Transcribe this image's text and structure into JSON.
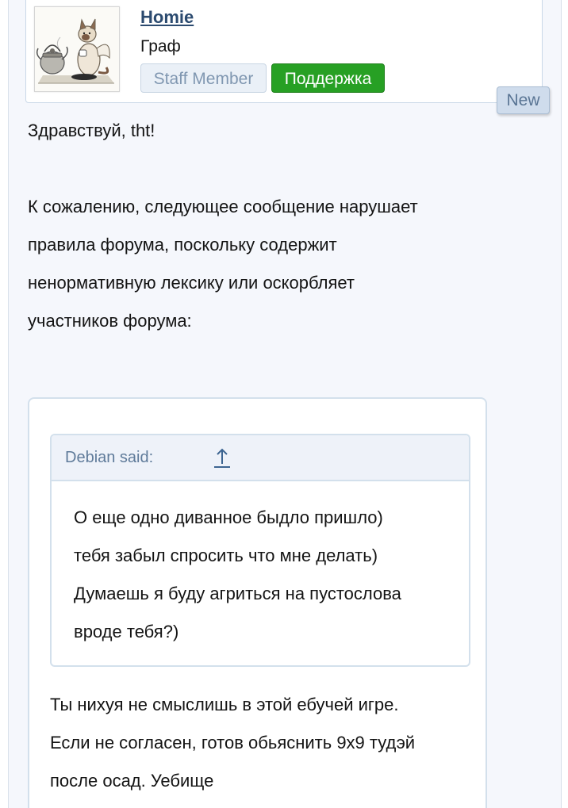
{
  "user": {
    "name": "Homie",
    "title": "Граф",
    "badges": {
      "staff": "Staff Member",
      "support": "Поддержка"
    },
    "avatar_icon": "cat-with-teapot-avatar"
  },
  "new_badge": "New",
  "message": {
    "greeting": "Здравствуй, tht!",
    "body_lines": [
      "К сожалению, следующее сообщение нарушает",
      "правила форума, поскольку содержит",
      "ненормативную лексику или оскорбляет",
      "участников форума:"
    ]
  },
  "quote": {
    "author_label": "Debian said:",
    "jump_icon": "arrow-up-icon",
    "lines": [
      "О еще одно диванное быдло пришло)",
      "тебя забыл спросить что мне делать)",
      "Думаешь я буду агриться на пустослова",
      "вроде тебя?)"
    ]
  },
  "reply": {
    "lines": [
      "Ты нихуя не смыслишь в этой ебучей игре.",
      "Если не согласен, готов обьяснить 9х9 тудэй",
      "после осад. Уебище"
    ]
  },
  "colors": {
    "username": "#2b4a6f",
    "support_badge": "#27a024",
    "staff_badge_bg": "#eaf0f7",
    "border": "#d3e0ec",
    "page_bg": "#f5f7fc"
  }
}
